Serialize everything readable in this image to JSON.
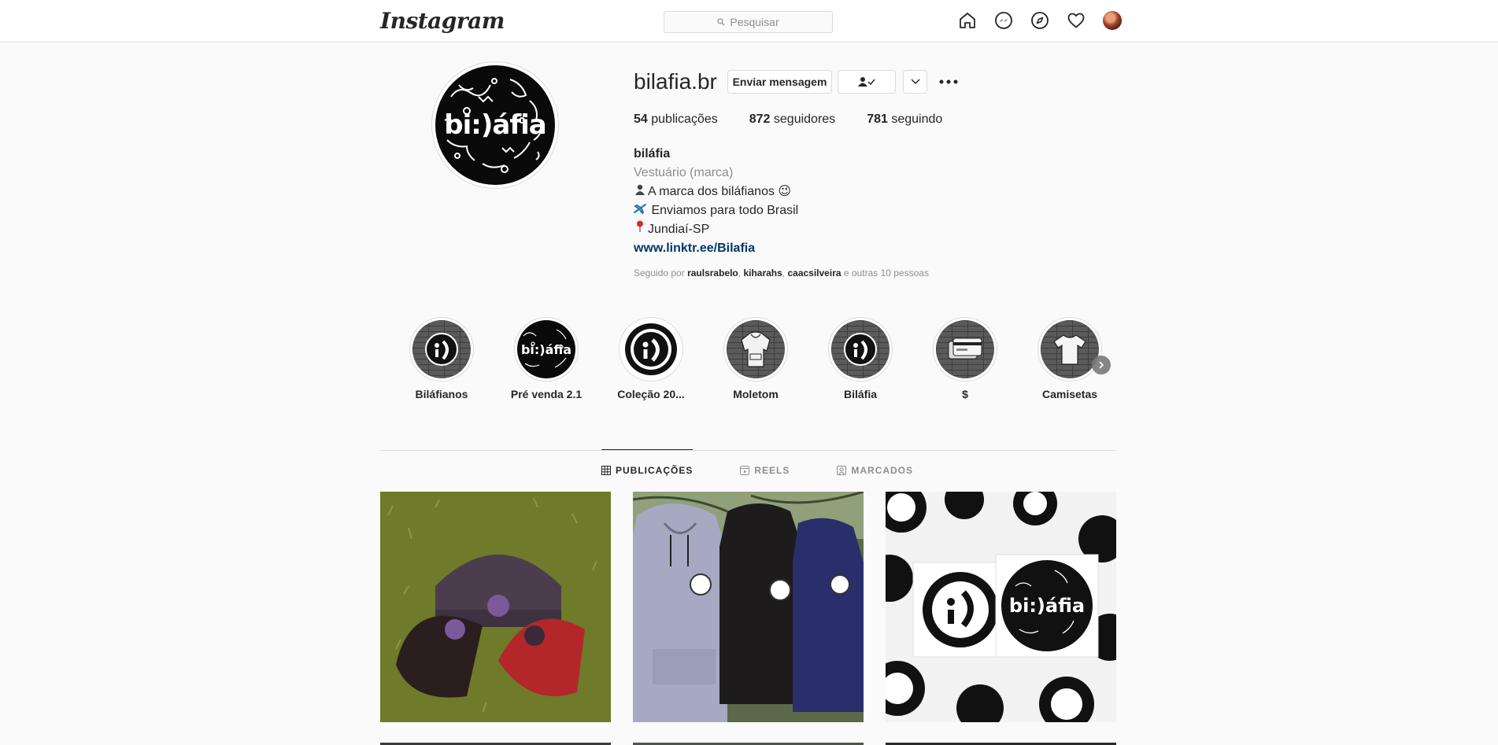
{
  "nav": {
    "logo": "Instagram",
    "search_placeholder": "Pesquisar"
  },
  "profile": {
    "username": "bilafia.br",
    "avatar_wordmark": "bi:)áfia",
    "buttons": {
      "message": "Enviar mensagem",
      "following": "👤✓",
      "dropdown": "⌄",
      "more": "•••"
    },
    "stats": {
      "posts_count": "54",
      "posts_label": "publicações",
      "followers_count": "872",
      "followers_label": "seguidores",
      "following_count": "781",
      "following_label": "seguindo"
    },
    "bio": {
      "full_name": "biláfia",
      "category": "Vestuário (marca)",
      "line1": "A marca dos biláfianos 😉",
      "line2": " Enviamos para todo Brasil",
      "line3": "Jundiaí-SP",
      "link": "www.linktr.ee/Bilafia"
    },
    "followed_by": {
      "prefix": "Seguido por",
      "user1": "raulsrabelo",
      "user2": "kiharahs",
      "user3": "caacsilveira",
      "suffix": "e outras 10 pessoas"
    }
  },
  "highlights": [
    {
      "label": "Biláfianos",
      "icon": "smiley-logo-icon"
    },
    {
      "label": "Pré venda 2.1",
      "icon": "wordmark-icon"
    },
    {
      "label": "Coleção 20...",
      "icon": "smiley-logo-icon"
    },
    {
      "label": "Moletom",
      "icon": "hoodie-icon"
    },
    {
      "label": "Biláfia",
      "icon": "smiley-logo-icon"
    },
    {
      "label": "$",
      "icon": "credit-card-icon"
    },
    {
      "label": "Camisetas",
      "icon": "tshirt-icon"
    }
  ],
  "tabs": {
    "posts": "PUBLICAÇÕES",
    "reels": "REELS",
    "tagged": "MARCADOS"
  },
  "colors": {
    "link": "#00376b",
    "secondary_text": "#8e8e8e",
    "border": "#dbdbdb"
  }
}
